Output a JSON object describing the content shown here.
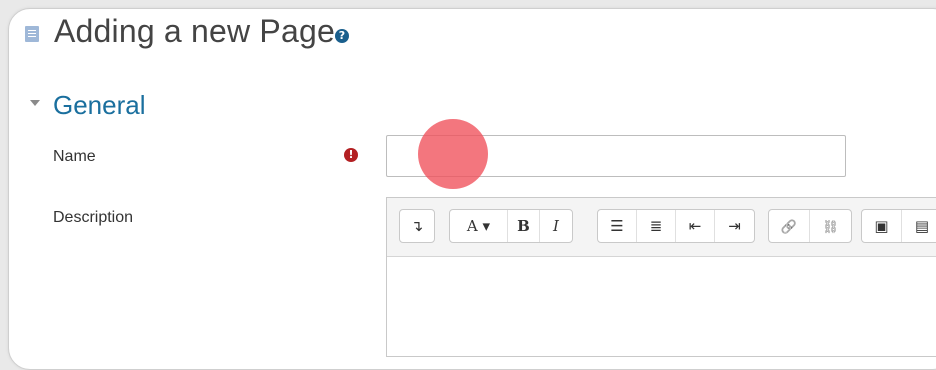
{
  "page": {
    "title": "Adding a new Page",
    "help_glyph": "?"
  },
  "section": {
    "title": "General"
  },
  "form": {
    "name_label": "Name",
    "name_value": "",
    "required_glyph": "!",
    "description_label": "Description"
  },
  "toolbar": {
    "show_more": "↴",
    "font_style": "A ▾",
    "bold": "B",
    "italic": "I",
    "unordered_list": "☰",
    "ordered_list": "≣",
    "outdent": "⇤",
    "indent": "⇥",
    "link": "🔗",
    "unlink": "⛓",
    "image": "▣",
    "media": "▤"
  },
  "colors": {
    "section_blue": "#1a6f9e",
    "required_red": "#b32023",
    "click_marker": "#f0505a"
  }
}
